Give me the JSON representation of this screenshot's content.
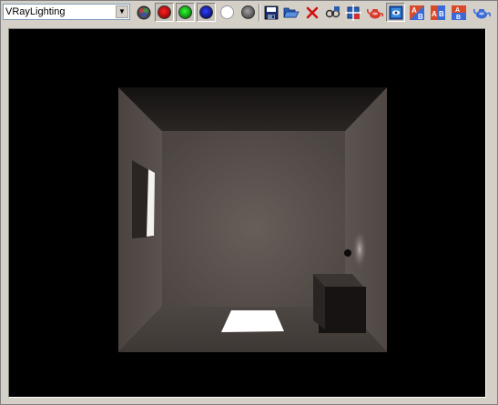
{
  "toolbar": {
    "channel_select": {
      "value": "VRayLighting"
    },
    "buttons": [
      {
        "name": "rgb-channels-icon",
        "color": "#6a6a6a"
      },
      {
        "name": "red-channel-icon",
        "color": "#c00000"
      },
      {
        "name": "green-channel-icon",
        "color": "#00b000"
      },
      {
        "name": "blue-channel-icon",
        "color": "#1020a0"
      },
      {
        "name": "alpha-channel-icon",
        "color": "#ffffff"
      },
      {
        "name": "mono-channel-icon",
        "color": "#707070"
      },
      {
        "name": "save-icon"
      },
      {
        "name": "open-icon"
      },
      {
        "name": "clear-icon"
      },
      {
        "name": "track-mouse-icon"
      },
      {
        "name": "region-render-icon"
      },
      {
        "name": "render-last-icon"
      },
      {
        "name": "view-frame-icon"
      },
      {
        "name": "compare-a-icon"
      },
      {
        "name": "compare-ab-icon"
      },
      {
        "name": "compare-b-icon"
      },
      {
        "name": "teapot-icon"
      }
    ]
  },
  "colors": {
    "back_wall": "#5f5753",
    "side_wall": "#504844",
    "floor": "#4a4340",
    "ceiling": "#1e1b1a",
    "highlight": "#ffffff"
  }
}
